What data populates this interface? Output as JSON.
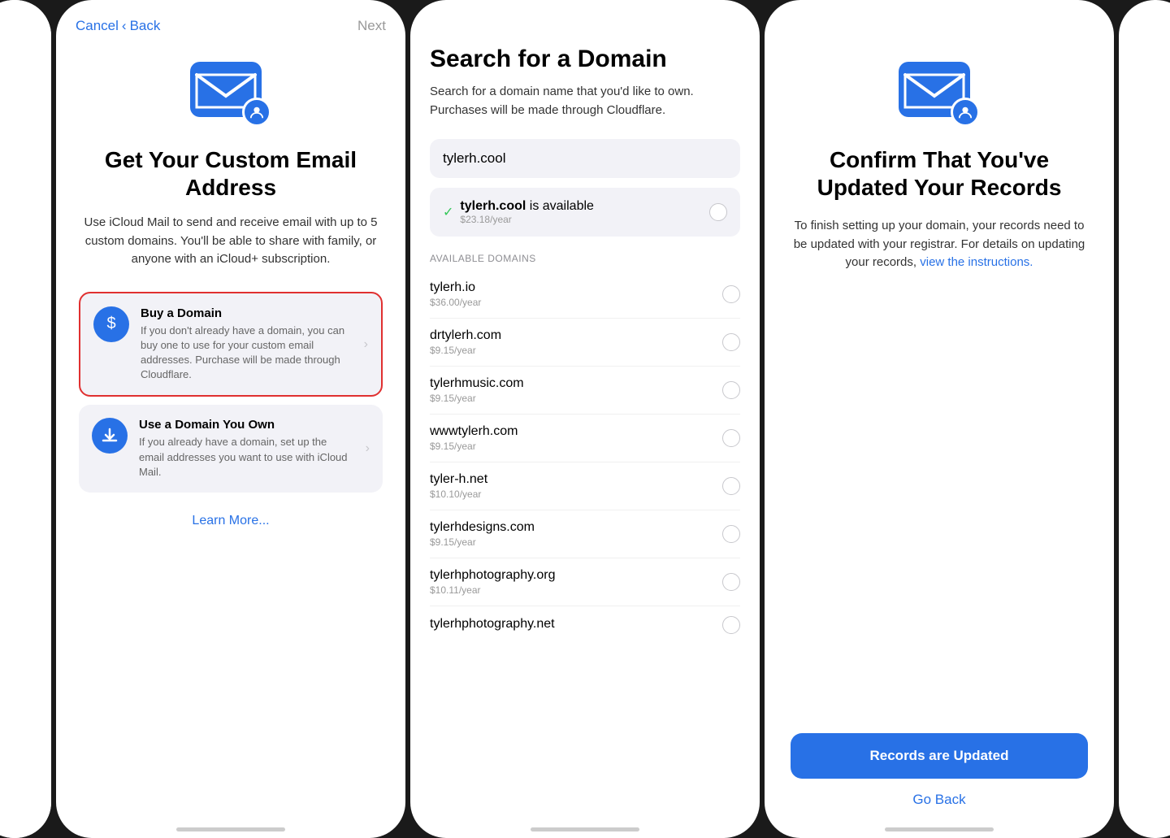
{
  "nav": {
    "cancel": "Cancel",
    "back": "Back",
    "chevron": "‹",
    "next": "Next"
  },
  "screen1": {
    "title": "Get Your Custom Email Address",
    "subtitle": "Use iCloud Mail to send and receive email with up to 5 custom domains. You'll be able to share with family, or anyone with an iCloud+ subscription.",
    "options": [
      {
        "title": "Buy a Domain",
        "desc": "If you don't already have a domain, you can buy one to use for your custom email addresses. Purchase will be made through Cloudflare.",
        "icon": "$",
        "highlighted": true
      },
      {
        "title": "Use a Domain You Own",
        "desc": "If you already have a domain, set up the email addresses you want to use with iCloud Mail.",
        "icon": "↓",
        "highlighted": false
      }
    ],
    "learn_more": "Learn More..."
  },
  "screen2": {
    "title": "Search for a Domain",
    "subtitle": "Search for a domain name that you'd like to own. Purchases will be made through Cloudflare.",
    "search_value": "tylerh.cool",
    "available_result": {
      "domain": "tylerh.cool",
      "suffix": " is available",
      "price": "$23.18/year"
    },
    "available_label": "AVAILABLE DOMAINS",
    "domains": [
      {
        "name": "tylerh.io",
        "price": "$36.00/year"
      },
      {
        "name": "drtylerh.com",
        "price": "$9.15/year"
      },
      {
        "name": "tylerhmusic.com",
        "price": "$9.15/year"
      },
      {
        "name": "wwwtylerh.com",
        "price": "$9.15/year"
      },
      {
        "name": "tyler-h.net",
        "price": "$10.10/year"
      },
      {
        "name": "tylerhdesigns.com",
        "price": "$9.15/year"
      },
      {
        "name": "tylerhphotography.org",
        "price": "$10.11/year"
      },
      {
        "name": "tylerhphotography.net",
        "price": ""
      }
    ]
  },
  "screen3": {
    "title": "Confirm That You've Updated Your Records",
    "desc_part1": "To finish setting up your domain, your records need to be updated with your registrar. For details on updating your records, ",
    "desc_link": "view the instructions.",
    "records_btn": "Records are Updated",
    "go_back": "Go Back"
  }
}
